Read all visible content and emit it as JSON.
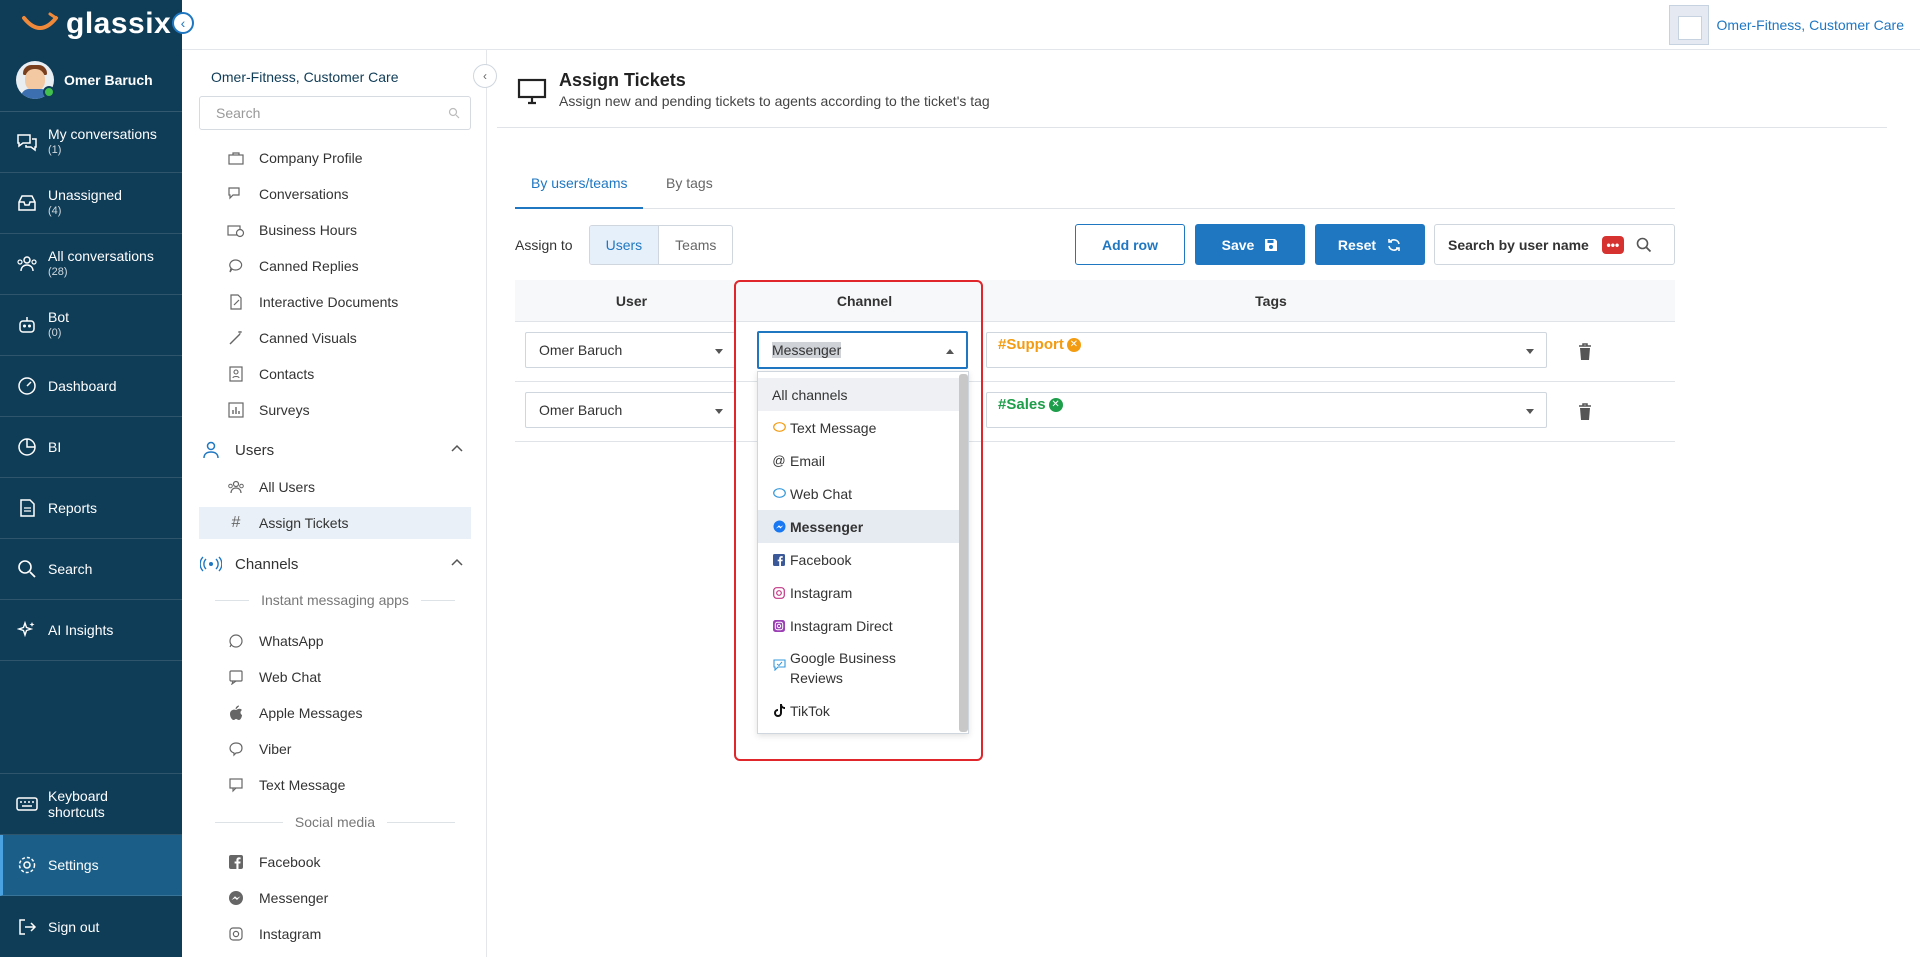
{
  "app": {
    "logo": "glassix",
    "collapse_glyph": "‹"
  },
  "user": {
    "name": "Omer Baruch"
  },
  "nav": [
    {
      "name": "my-conversations",
      "label": "My conversations",
      "count": "(1)"
    },
    {
      "name": "unassigned",
      "label": "Unassigned",
      "count": "(4)"
    },
    {
      "name": "all-conversations",
      "label": "All conversations",
      "count": "(28)"
    },
    {
      "name": "bot",
      "label": "Bot",
      "count": "(0)"
    },
    {
      "name": "dashboard",
      "label": "Dashboard",
      "count": ""
    },
    {
      "name": "bi",
      "label": "BI",
      "count": ""
    },
    {
      "name": "reports",
      "label": "Reports",
      "count": ""
    },
    {
      "name": "search",
      "label": "Search",
      "count": ""
    },
    {
      "name": "ai-insights",
      "label": "AI Insights",
      "count": ""
    }
  ],
  "nav_bottom": {
    "keyboard_line1": "Keyboard",
    "keyboard_line2": "shortcuts",
    "settings": "Settings",
    "signout": "Sign out"
  },
  "topbar": {
    "company": "Omer-Fitness, Customer Care"
  },
  "settings": {
    "org": "Omer-Fitness, Customer Care",
    "search_placeholder": "Search",
    "items_top": [
      "Company Profile",
      "Conversations",
      "Business Hours",
      "Canned Replies",
      "Interactive Documents",
      "Canned Visuals",
      "Contacts",
      "Surveys"
    ],
    "users_group": "Users",
    "users_items": [
      "All Users",
      "Assign Tickets"
    ],
    "channels_group": "Channels",
    "im_divider": "Instant messaging apps",
    "im_items": [
      "WhatsApp",
      "Web Chat",
      "Apple Messages",
      "Viber",
      "Text Message"
    ],
    "social_divider": "Social media",
    "social_items": [
      "Facebook",
      "Messenger",
      "Instagram"
    ]
  },
  "page": {
    "title": "Assign Tickets",
    "subtitle": "Assign new and pending tickets to agents according to the ticket's tag",
    "tab_users": "By users/teams",
    "tab_tags": "By tags",
    "assign_to": "Assign to",
    "seg_users": "Users",
    "seg_teams": "Teams",
    "add_row": "Add row",
    "save": "Save",
    "reset": "Reset",
    "search_user": "Search by user name",
    "search_badge": "•••"
  },
  "table": {
    "headers": {
      "user": "User",
      "channel": "Channel",
      "tags": "Tags"
    },
    "rows": [
      {
        "user": "Omer Baruch",
        "channel": "Messenger",
        "tag": "#Support",
        "tag_color": "#f39c12"
      },
      {
        "user": "Omer Baruch",
        "channel": "",
        "tag": "#Sales",
        "tag_color": "#1e9e4a"
      }
    ]
  },
  "dropdown": {
    "options": [
      {
        "label": "All channels",
        "icon": "none"
      },
      {
        "label": "Text Message",
        "icon": "sms-icon"
      },
      {
        "label": "Email",
        "icon": "at-icon"
      },
      {
        "label": "Web Chat",
        "icon": "webchat-icon"
      },
      {
        "label": "Messenger",
        "icon": "messenger-icon"
      },
      {
        "label": "Facebook",
        "icon": "facebook-icon"
      },
      {
        "label": "Instagram",
        "icon": "instagram-icon"
      },
      {
        "label": "Instagram Direct",
        "icon": "instagram-direct-icon"
      },
      {
        "label": "Google Business Reviews",
        "icon": "google-reviews-icon"
      },
      {
        "label": "TikTok",
        "icon": "tiktok-icon"
      }
    ],
    "selected": "Messenger"
  },
  "colors": {
    "primary": "#1f77c2",
    "nav_bg": "#0f3c57",
    "highlight": "#e0262b"
  }
}
